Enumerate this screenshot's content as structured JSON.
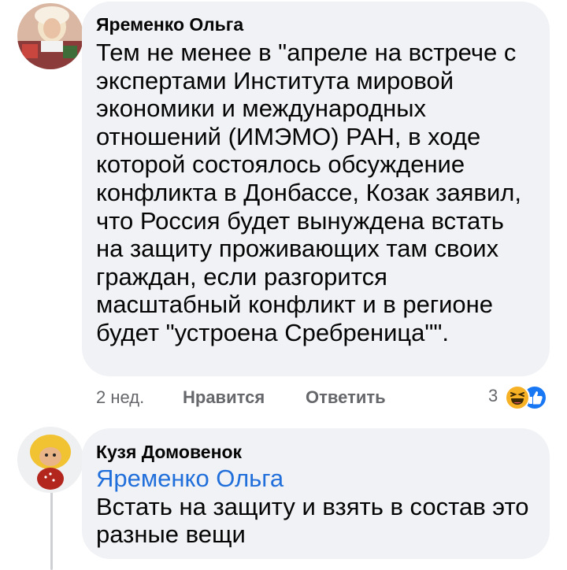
{
  "comments": [
    {
      "author": "Яременко Ольга",
      "lines": [
        "Тем не менее в \"апреле на встрече с",
        "экспертами Института мировой",
        "экономики и международных",
        "отношений (ИМЭМО) РАН, в ходе",
        "которой состоялось обсуждение",
        "конфликта в Донбассе, Козак заявил,",
        "что Россия будет вынуждена встать",
        "на защиту проживающих там своих",
        "граждан, если разгорится",
        "масштабный конфликт и в регионе",
        "будет \"устроена Сребреница\"\"."
      ],
      "time": "2 нед.",
      "like_label": "Нравится",
      "reply_label": "Ответить",
      "reaction_count": "3",
      "reaction_icons": [
        "haha-icon",
        "like-icon"
      ],
      "colors": {
        "haha": "#f7b125",
        "like": "#1877f2"
      }
    },
    {
      "author": "Кузя Домовенок",
      "mention": "Яременко Ольга",
      "lines": [
        "Встать на защиту и взять в состав это",
        "разные вещи"
      ]
    }
  ],
  "colors": {
    "bubble": "#f0f2f5",
    "text": "#050505",
    "secondary": "#65676b",
    "mention": "#216fdb"
  }
}
